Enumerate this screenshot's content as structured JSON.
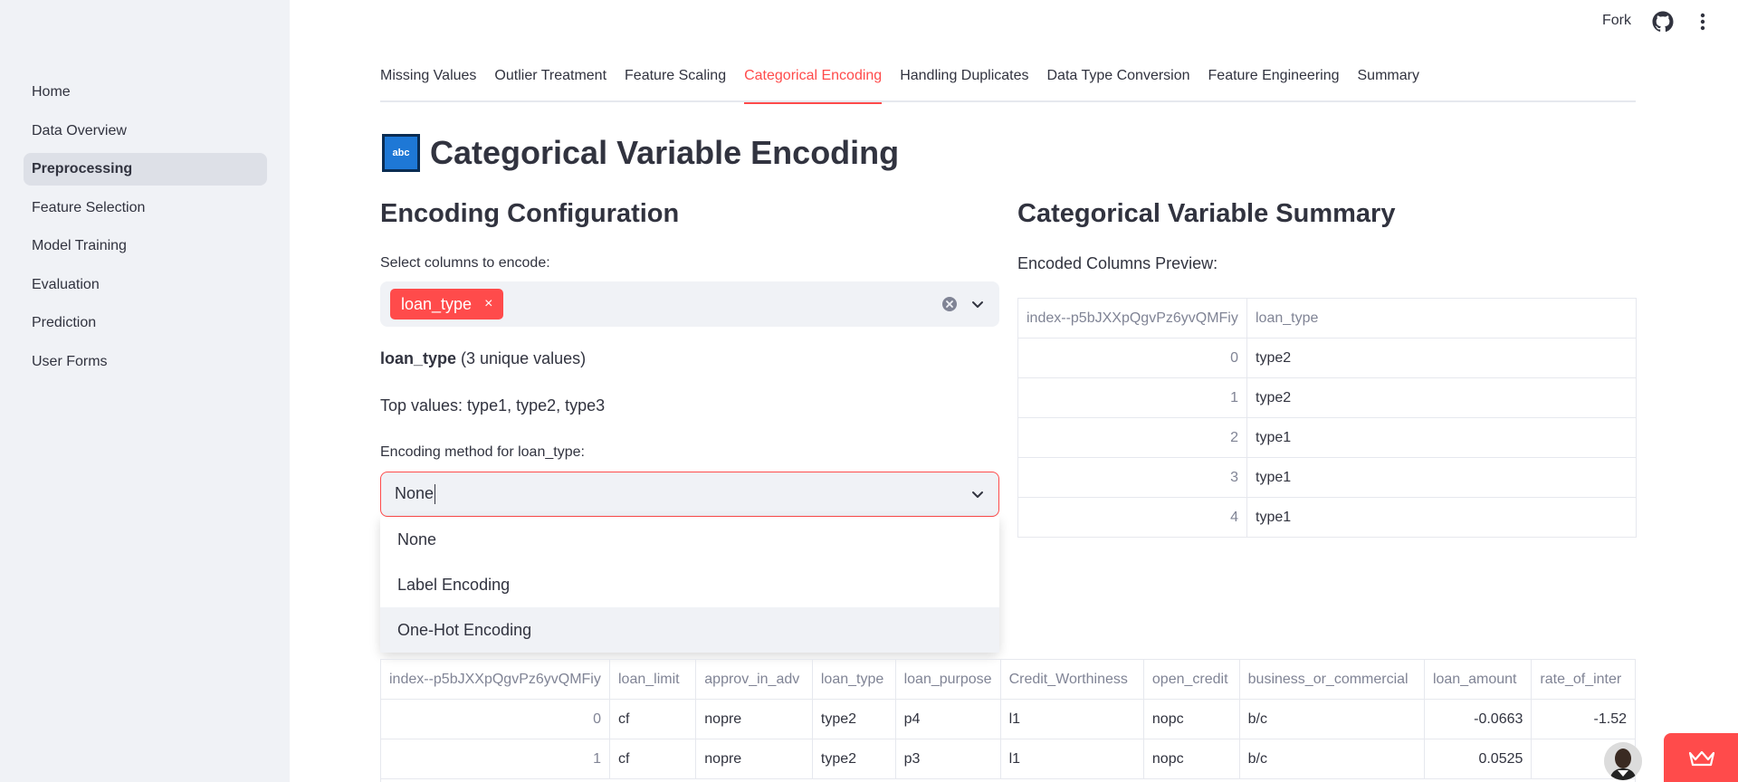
{
  "sidebar": {
    "items": [
      {
        "label": "Home"
      },
      {
        "label": "Data Overview"
      },
      {
        "label": "Preprocessing"
      },
      {
        "label": "Feature Selection"
      },
      {
        "label": "Model Training"
      },
      {
        "label": "Evaluation"
      },
      {
        "label": "Prediction"
      },
      {
        "label": "User Forms"
      }
    ],
    "active": "Preprocessing"
  },
  "topbar": {
    "fork_label": "Fork",
    "github_icon": "github-icon",
    "menu_icon": "kebab-menu-icon"
  },
  "tabs": [
    {
      "label": "Missing Values"
    },
    {
      "label": "Outlier Treatment"
    },
    {
      "label": "Feature Scaling"
    },
    {
      "label": "Categorical Encoding"
    },
    {
      "label": "Handling Duplicates"
    },
    {
      "label": "Data Type Conversion"
    },
    {
      "label": "Feature Engineering"
    },
    {
      "label": "Summary"
    }
  ],
  "active_tab": "Categorical Encoding",
  "page": {
    "icon_text": "abc",
    "title": "Categorical Variable Encoding"
  },
  "config": {
    "heading": "Encoding Configuration",
    "select_label": "Select columns to encode:",
    "selected_chip": "loan_type",
    "chip_remove": "×",
    "column_name": "loan_type",
    "unique_values": " (3 unique values)",
    "top_values": "Top values: type1, type2, type3",
    "method_label": "Encoding method for loan_type:",
    "method_value": "None",
    "options": [
      "None",
      "Label Encoding",
      "One-Hot Encoding"
    ],
    "highlighted_option": "One-Hot Encoding"
  },
  "summary": {
    "heading": "Categorical Variable Summary",
    "preview_label": "Encoded Columns Preview:",
    "columns": [
      "index--p5bJXXpQgvPz6yvQMFiy",
      "loan_type"
    ],
    "rows": [
      [
        "0",
        "type2"
      ],
      [
        "1",
        "type2"
      ],
      [
        "2",
        "type1"
      ],
      [
        "3",
        "type1"
      ],
      [
        "4",
        "type1"
      ]
    ]
  },
  "data_table": {
    "columns": [
      "index--p5bJXXpQgvPz6yvQMFiy",
      "loan_limit",
      "approv_in_adv",
      "loan_type",
      "loan_purpose",
      "Credit_Worthiness",
      "open_credit",
      "business_or_commercial",
      "loan_amount",
      "rate_of_inter"
    ],
    "rows": [
      [
        "0",
        "cf",
        "nopre",
        "type2",
        "p4",
        "l1",
        "nopc",
        "b/c",
        "-0.0663",
        "-1.52"
      ],
      [
        "1",
        "cf",
        "nopre",
        "type2",
        "p3",
        "l1",
        "nopc",
        "b/c",
        "0.0525",
        ""
      ]
    ]
  },
  "colors": {
    "accent": "#ff4b4b",
    "sidebar_bg": "#f0f2f6",
    "text": "#31333f"
  }
}
